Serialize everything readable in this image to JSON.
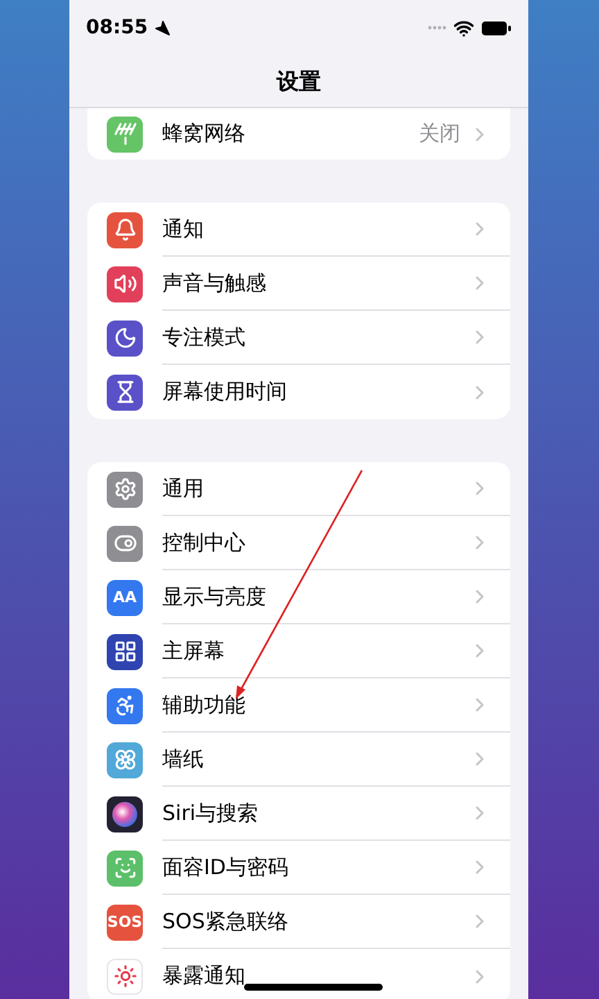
{
  "status_bar": {
    "time": "08:55"
  },
  "title": "设置",
  "groups": [
    {
      "items": [
        {
          "label": "蜂窝网络",
          "value": "关闭"
        }
      ]
    },
    {
      "items": [
        {
          "label": "通知"
        },
        {
          "label": "声音与触感"
        },
        {
          "label": "专注模式"
        },
        {
          "label": "屏幕使用时间"
        }
      ]
    },
    {
      "items": [
        {
          "label": "通用"
        },
        {
          "label": "控制中心"
        },
        {
          "label": "显示与亮度",
          "icon_text": "AA"
        },
        {
          "label": "主屏幕"
        },
        {
          "label": "辅助功能"
        },
        {
          "label": "墙纸"
        },
        {
          "label": "Siri与搜索"
        },
        {
          "label": "面容ID与密码"
        },
        {
          "label": "SOS紧急联络",
          "icon_text": "SOS"
        },
        {
          "label": "暴露通知"
        }
      ]
    }
  ]
}
